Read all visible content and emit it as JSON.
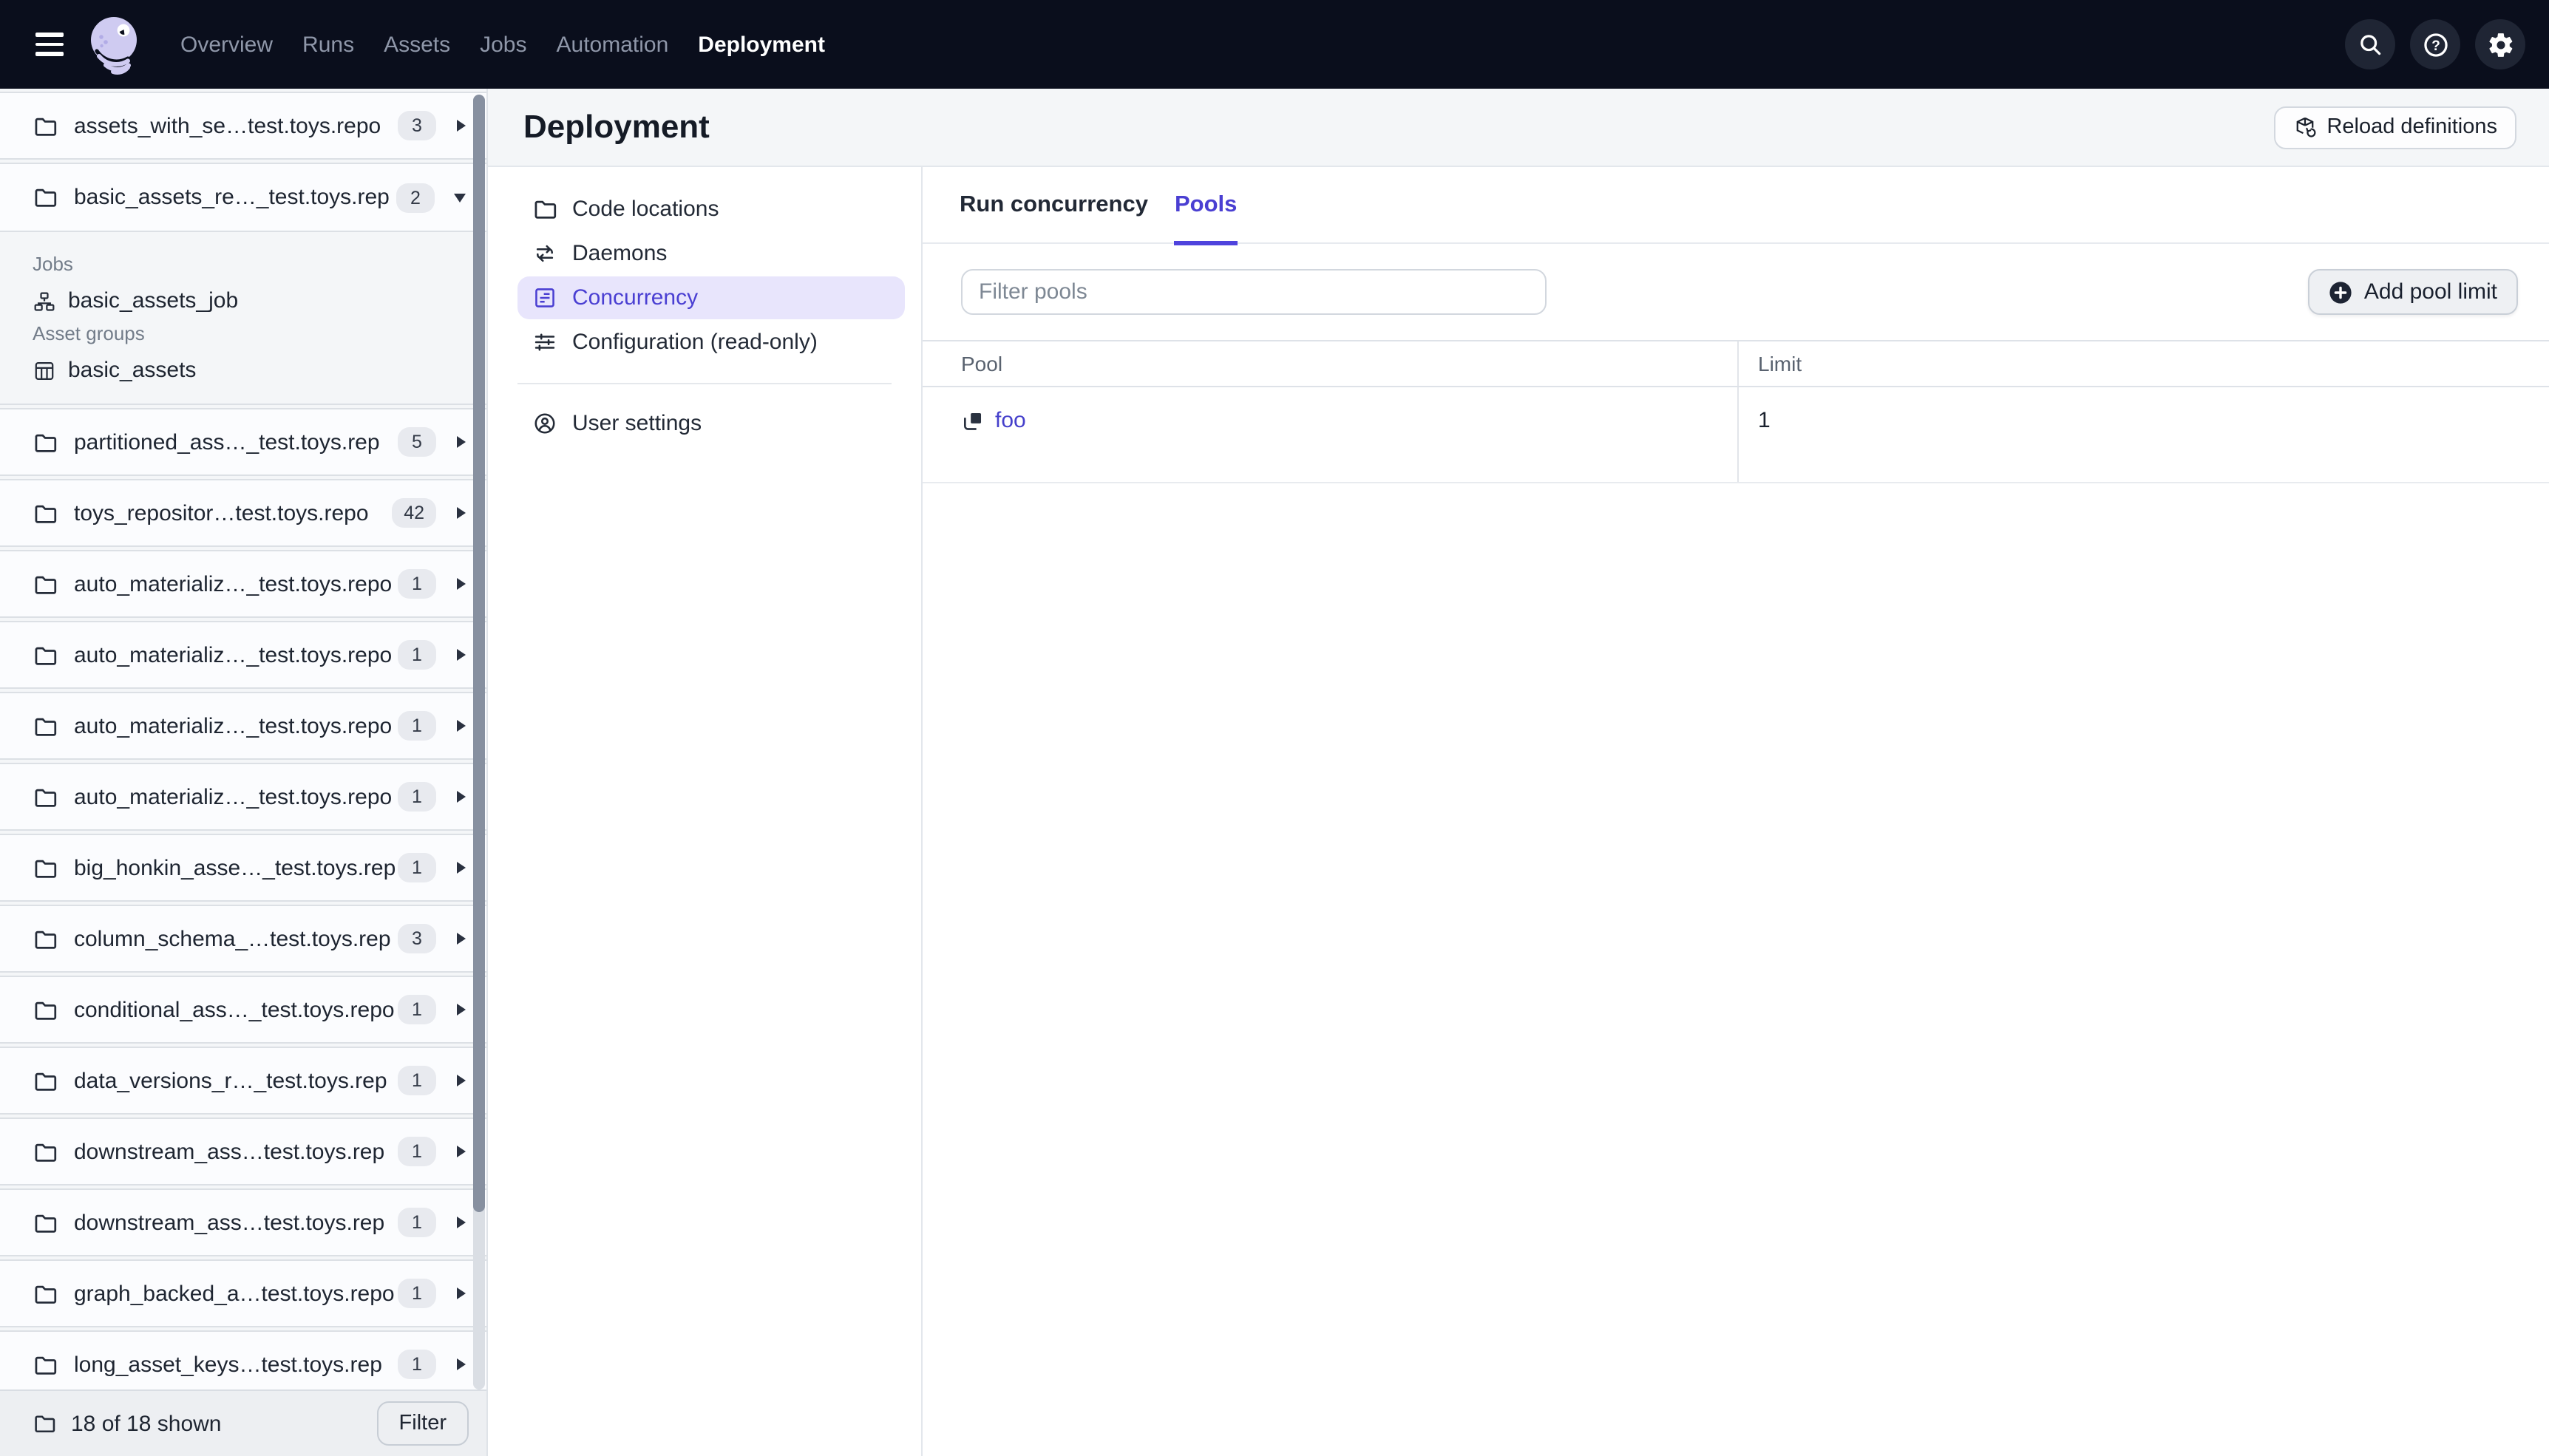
{
  "topnav": {
    "nav_items": [
      {
        "label": "Overview",
        "active": false
      },
      {
        "label": "Runs",
        "active": false
      },
      {
        "label": "Assets",
        "active": false
      },
      {
        "label": "Jobs",
        "active": false
      },
      {
        "label": "Automation",
        "active": false
      },
      {
        "label": "Deployment",
        "active": true
      }
    ],
    "action_icons": [
      "search-icon",
      "help-icon",
      "settings-icon"
    ]
  },
  "sidebar": {
    "repo1": {
      "name": "assets_with_se…test.toys.repo",
      "count": "3"
    },
    "repo2": {
      "name": "basic_assets_re…_test.toys.rep",
      "count": "2"
    },
    "expanded": {
      "jobs_label": "Jobs",
      "job_name": "basic_assets_job",
      "groups_label": "Asset groups",
      "group_name": "basic_assets"
    },
    "repos": [
      {
        "name": "partitioned_ass…_test.toys.rep",
        "count": "5"
      },
      {
        "name": "toys_repositor…test.toys.repo",
        "count": "42"
      },
      {
        "name": "auto_materializ…_test.toys.repo",
        "count": "1"
      },
      {
        "name": "auto_materializ…_test.toys.repo",
        "count": "1"
      },
      {
        "name": "auto_materializ…_test.toys.repo",
        "count": "1"
      },
      {
        "name": "auto_materializ…_test.toys.repo",
        "count": "1"
      },
      {
        "name": "big_honkin_asse…_test.toys.rep",
        "count": "1"
      },
      {
        "name": "column_schema_…test.toys.rep",
        "count": "3"
      },
      {
        "name": "conditional_ass…_test.toys.repo",
        "count": "1"
      },
      {
        "name": "data_versions_r…_test.toys.rep",
        "count": "1"
      },
      {
        "name": "downstream_ass…test.toys.rep",
        "count": "1"
      },
      {
        "name": "downstream_ass…test.toys.rep",
        "count": "1"
      },
      {
        "name": "graph_backed_a…test.toys.repo",
        "count": "1"
      },
      {
        "name": "long_asset_keys…test.toys.rep",
        "count": "1"
      }
    ],
    "footer": {
      "status": "18 of 18 shown",
      "filter_label": "Filter"
    }
  },
  "page": {
    "title": "Deployment",
    "reload_label": "Reload definitions"
  },
  "subnav": {
    "code_locations": "Code locations",
    "daemons": "Daemons",
    "concurrency": "Concurrency",
    "configuration": "Configuration (read-only)",
    "user_settings": "User settings"
  },
  "tabs": {
    "run_concurrency": "Run concurrency",
    "pools": "Pools"
  },
  "toolbar": {
    "filter_placeholder": "Filter pools",
    "add_pool_label": "Add pool limit"
  },
  "pools_table": {
    "headers": {
      "pool": "Pool",
      "limit": "Limit"
    },
    "rows": [
      {
        "pool": "foo",
        "limit": "1"
      }
    ]
  },
  "colors": {
    "topnav_bg": "#0A0E1C",
    "accent": "#4F43DD",
    "link": "#4540CB",
    "selected_bg": "#E8E5FC",
    "sidebar_bg": "#F4F6F8"
  }
}
